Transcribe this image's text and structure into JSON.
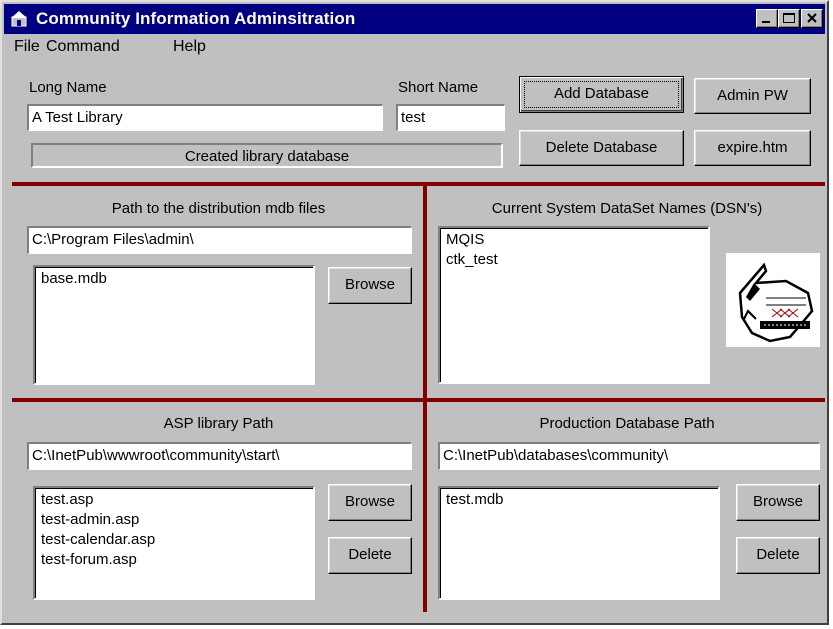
{
  "window": {
    "title": "Community Information Adminsitration"
  },
  "menu": {
    "items": [
      "File",
      "Command",
      "Help"
    ]
  },
  "top": {
    "long_name_label": "Long Name",
    "long_name_value": "A Test Library",
    "short_name_label": "Short Name",
    "short_name_value": "test",
    "status_text": "Created library database",
    "add_database_label": "Add Database",
    "admin_pw_label": "Admin PW",
    "delete_database_label": "Delete Database",
    "expire_label": "expire.htm"
  },
  "distribution": {
    "heading": "Path to the distribution  mdb files",
    "path": "C:\\Program Files\\admin\\",
    "files": [
      "base.mdb"
    ],
    "browse_label": "Browse"
  },
  "dsn": {
    "heading": "Current System DataSet Names (DSN's)",
    "names": [
      "MQIS",
      "ctk_test"
    ]
  },
  "asp": {
    "heading": "ASP library Path",
    "path": "C:\\InetPub\\wwwroot\\community\\start\\",
    "files": [
      "test.asp",
      "test-admin.asp",
      "test-calendar.asp",
      "test-forum.asp"
    ],
    "browse_label": "Browse",
    "delete_label": "Delete"
  },
  "production": {
    "heading": "Production Database Path",
    "path": "C:\\InetPub\\databases\\community\\",
    "files": [
      "test.mdb"
    ],
    "browse_label": "Browse",
    "delete_label": "Delete"
  },
  "colors": {
    "titlebar": "#000080",
    "divider": "#800000",
    "face": "#c0c0c0"
  }
}
